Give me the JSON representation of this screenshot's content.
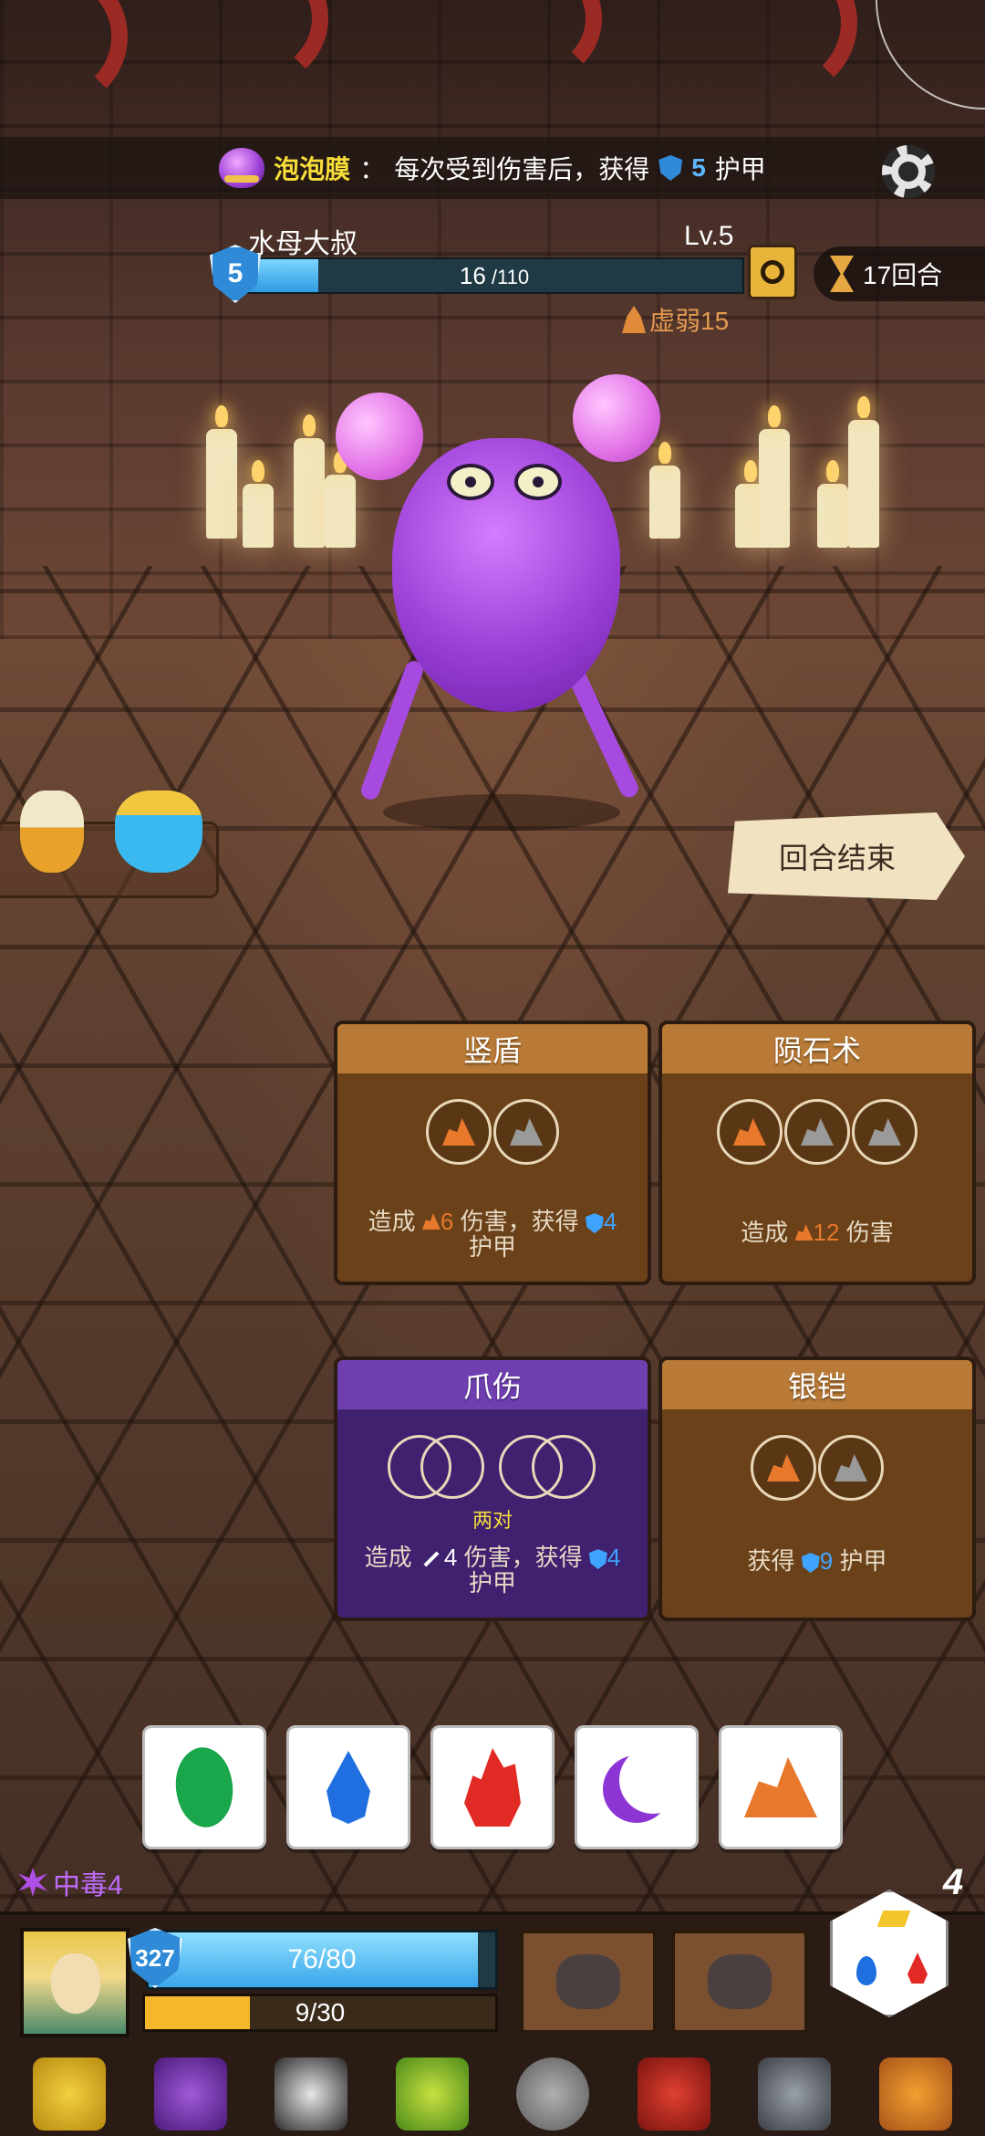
{
  "buff": {
    "name": "泡泡膜",
    "sep": "：",
    "text_before": "每次受到伤害后，获得",
    "value": "5",
    "text_after": "护甲"
  },
  "enemy": {
    "name": "水母大叔",
    "level": "Lv.5",
    "shield": "5",
    "hp_current": "16",
    "hp_max": " /110",
    "hp_fraction": 0.145,
    "status": "虚弱15"
  },
  "turn": {
    "label": "17回合"
  },
  "end_turn": {
    "label": "回合结束"
  },
  "cards": [
    {
      "title": "竖盾",
      "desc_pre": "造成",
      "dmg": "6",
      "mid": "伤害，获得",
      "armor": "4",
      "post": "护甲",
      "color": "orange"
    },
    {
      "title": "陨石术",
      "desc_pre": "造成",
      "dmg": "12",
      "post": "伤害",
      "color": "orange"
    },
    {
      "title": "爪伤",
      "pair": "两对",
      "desc_pre": "造成",
      "dmg": "4",
      "mid": "伤害，获得",
      "armor": "4",
      "post": "护甲",
      "color": "purple"
    },
    {
      "title": "银铠",
      "desc_pre": "获得",
      "armor": "9",
      "post": "护甲",
      "color": "orange"
    }
  ],
  "dice": [
    "leaf-icon",
    "water-drop-icon",
    "fire-icon",
    "moon-icon",
    "rock-icon"
  ],
  "player": {
    "poison": "中毒4",
    "shield": "327",
    "hp": "76/80",
    "hp_fraction": 0.95,
    "energy": "9/30",
    "energy_fraction": 0.3,
    "dice_count": "4"
  },
  "colors": {
    "hp_blue": "#3aa6ea",
    "energy_yellow": "#f5b82c",
    "card_orange": "#b87a36",
    "card_purple": "#6f3fb0",
    "poison_purple": "#c06bff"
  }
}
